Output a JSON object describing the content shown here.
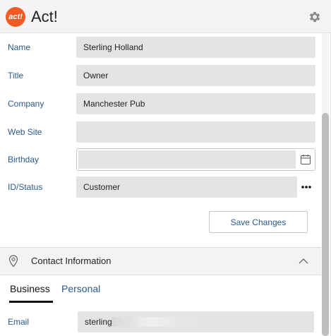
{
  "app": {
    "logo_text": "act!",
    "title": "Act!",
    "brand_color": "#f25b24"
  },
  "header": {
    "settings_icon": "gear-icon"
  },
  "fields": {
    "name": {
      "label": "Name",
      "value": "Sterling Holland"
    },
    "title": {
      "label": "Title",
      "value": "Owner"
    },
    "company": {
      "label": "Company",
      "value": "Manchester Pub"
    },
    "website": {
      "label": "Web Site",
      "value": ""
    },
    "birthday": {
      "label": "Birthday",
      "value": ""
    },
    "id_status": {
      "label": "ID/Status",
      "value": "Customer"
    }
  },
  "actions": {
    "save_label": "Save Changes"
  },
  "contact_section": {
    "title": "Contact Information",
    "icon": "map-pin-icon",
    "collapse_icon": "chevron-up-icon"
  },
  "tabs": [
    {
      "label": "Business",
      "active": true
    },
    {
      "label": "Personal",
      "active": false
    }
  ],
  "email": {
    "label": "Email",
    "value": "sterling."
  },
  "colors": {
    "label_color": "#2b5a8c",
    "field_bg": "#e4e4e4"
  }
}
